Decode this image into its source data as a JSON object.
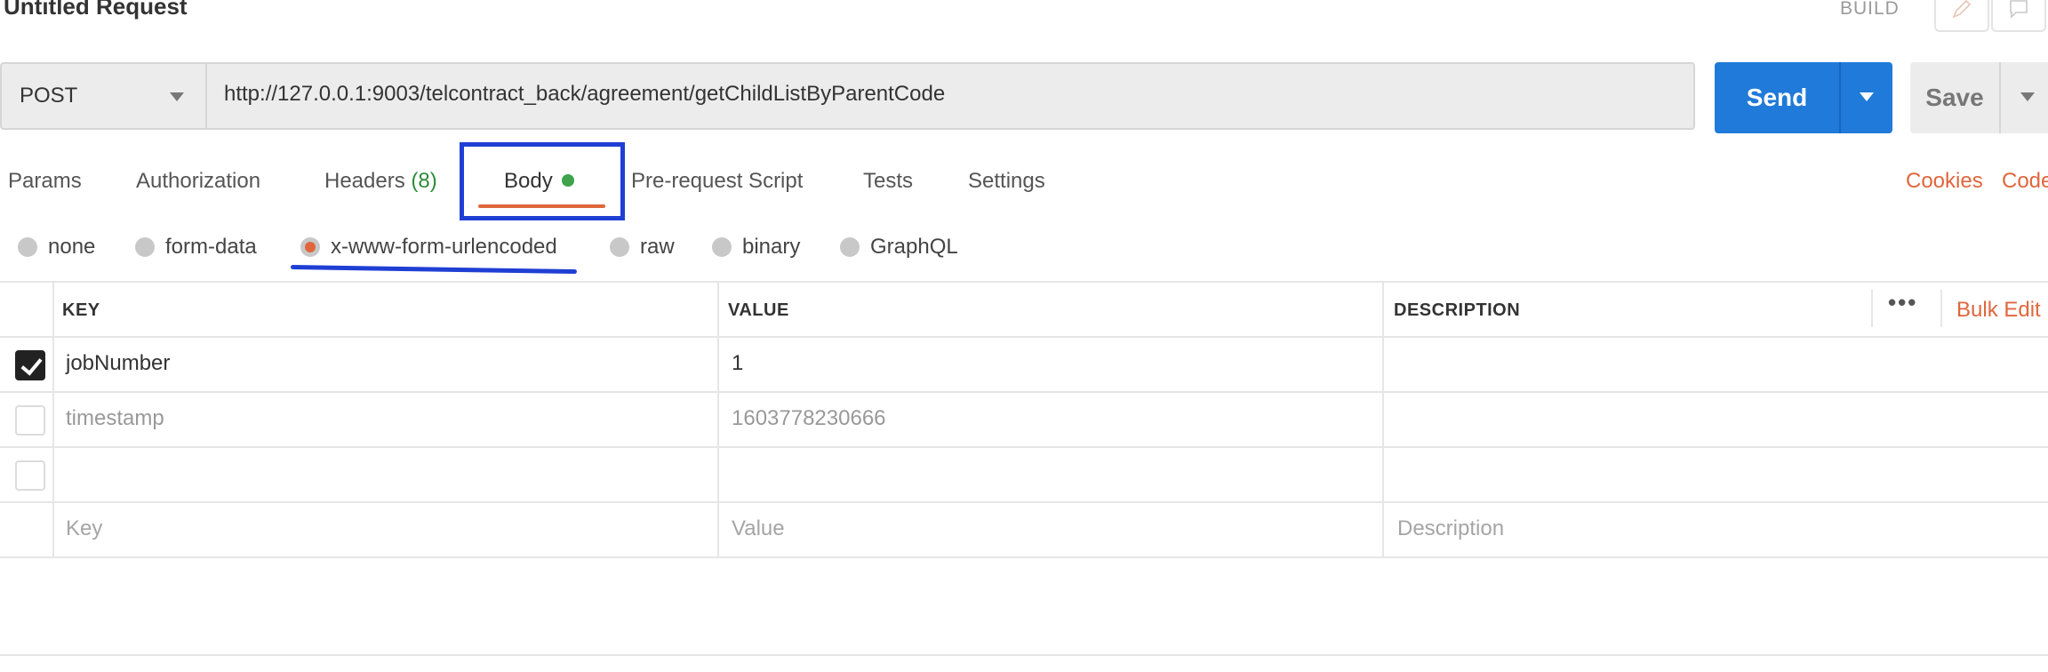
{
  "request": {
    "title": "Untitled Request",
    "mode": "BUILD"
  },
  "top_icons": [
    "pencil-icon",
    "comment-icon"
  ],
  "url_bar": {
    "method": "POST",
    "url": "http://127.0.0.1:9003/telcontract_back/agreement/getChildListByParentCode"
  },
  "actions": {
    "send_label": "Send",
    "save_label": "Save"
  },
  "tabs": {
    "params": "Params",
    "authorization": "Authorization",
    "headers": "Headers",
    "headers_count": "(8)",
    "body": "Body",
    "prerequest": "Pre-request Script",
    "tests": "Tests",
    "settings": "Settings",
    "active": "Body"
  },
  "links": {
    "cookies": "Cookies",
    "code": "Code"
  },
  "body_types": {
    "none": "none",
    "form_data": "form-data",
    "urlencoded": "x-www-form-urlencoded",
    "raw": "raw",
    "binary": "binary",
    "graphql": "GraphQL",
    "selected": "x-www-form-urlencoded"
  },
  "table": {
    "headers": {
      "key": "KEY",
      "value": "VALUE",
      "description": "DESCRIPTION"
    },
    "bulk_edit": "Bulk Edit",
    "rows": [
      {
        "checked": true,
        "key": "jobNumber",
        "value": "1",
        "description": ""
      },
      {
        "checked": false,
        "key": "timestamp",
        "value": "1603778230666",
        "description": ""
      },
      {
        "checked": false,
        "key": "",
        "value": "",
        "description": ""
      }
    ],
    "placeholders": {
      "key": "Key",
      "value": "Value",
      "description": "Description"
    }
  },
  "colors": {
    "accent": "#e0663d",
    "send_blue": "#1f7ad9",
    "annotation_blue": "#1f3fd4",
    "status_green": "#3ea34b"
  }
}
